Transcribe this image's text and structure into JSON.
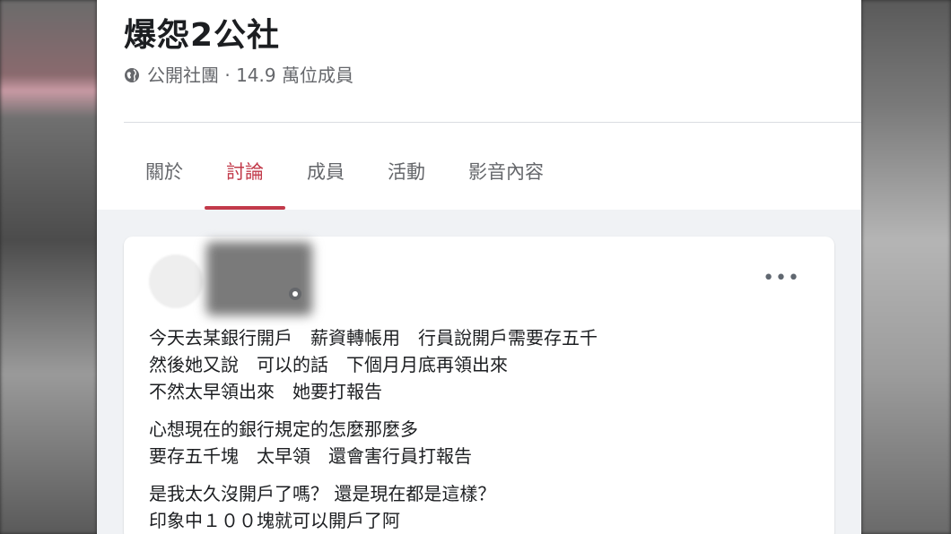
{
  "group": {
    "title": "爆怨2公社",
    "meta": "公開社團 · 14.9 萬位成員"
  },
  "tabs": [
    {
      "label": "關於",
      "active": false
    },
    {
      "label": "討論",
      "active": true
    },
    {
      "label": "成員",
      "active": false
    },
    {
      "label": "活動",
      "active": false
    },
    {
      "label": "影音內容",
      "active": false
    }
  ],
  "post": {
    "more_label": "•••",
    "paragraphs": [
      [
        "今天去某銀行開戶　薪資轉帳用　行員說開戶需要存五千",
        "然後她又說　可以的話　下個月月底再領出來",
        "不然太早領出來　她要打報告"
      ],
      [
        "心想現在的銀行規定的怎麼那麼多",
        "要存五千塊　太早領　還會害行員打報告"
      ],
      [
        "是我太久沒開戶了嗎？ 還是現在都是這樣？",
        "印象中１００塊就可以開戶了阿"
      ]
    ]
  },
  "colors": {
    "accent": "#c23a4a",
    "muted_text": "#65676b",
    "page_bg": "#f0f2f5"
  },
  "icons": {
    "group_privacy": "globe-icon",
    "post_privacy": "globe-icon",
    "more": "more-options-icon"
  }
}
